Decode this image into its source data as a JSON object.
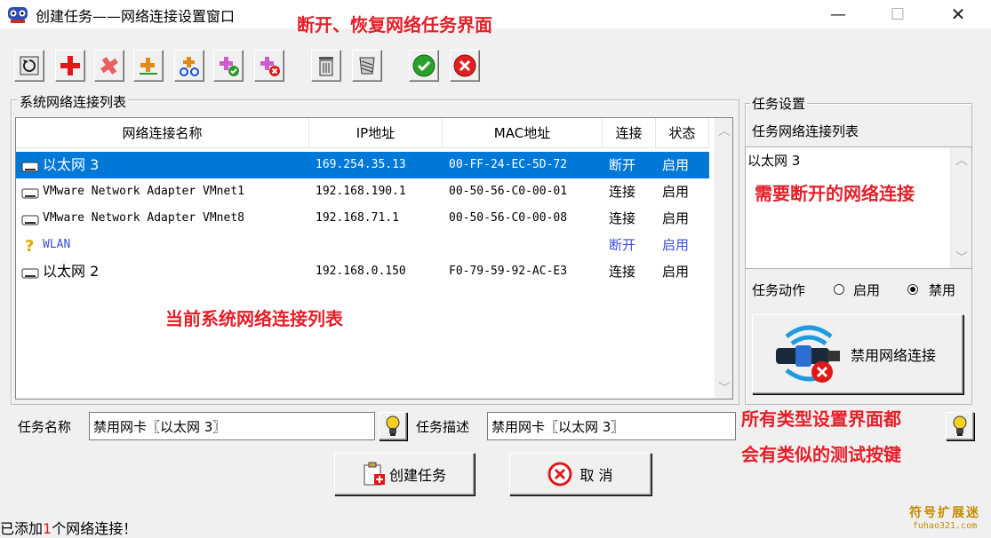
{
  "window": {
    "title": "创建任务——网络连接设置窗口",
    "app_icon": "network-globe-icon",
    "controls": {
      "minimize": "—",
      "maximize": "☐",
      "close": "✕"
    }
  },
  "annotations": {
    "top": "断开、恢复网络任务界面",
    "list": "当前系统网络连接列表",
    "right": "需要断开的网络连接",
    "bottom_line1": "所有类型设置界面都",
    "bottom_line2": "会有类似的测试按键"
  },
  "toolbar": {
    "buttons": [
      {
        "name": "refresh-button",
        "icon": "refresh-icon"
      },
      {
        "name": "add-button",
        "icon": "plus-icon"
      },
      {
        "name": "add-alt-button",
        "icon": "plus-hatched-icon"
      },
      {
        "name": "add-small-button",
        "icon": "plus-small-icon"
      },
      {
        "name": "add-network-button",
        "icon": "network-add-icon"
      },
      {
        "name": "add-network-alt-button",
        "icon": "network-bike-icon"
      },
      {
        "name": "add-enable-button",
        "icon": "plus-check-icon"
      },
      {
        "name": "add-disable-button",
        "icon": "plus-cross-icon"
      },
      {
        "name": "delete-button",
        "icon": "trash-icon"
      },
      {
        "name": "clear-button",
        "icon": "broom-icon"
      },
      {
        "name": "confirm-button",
        "icon": "check-circle-icon"
      },
      {
        "name": "cancel-button",
        "icon": "cross-circle-icon"
      }
    ]
  },
  "system_list": {
    "group_label": "系统网络连接列表",
    "columns": [
      "网络连接名称",
      "IP地址",
      "MAC地址",
      "连接",
      "状态"
    ],
    "rows": [
      {
        "name": "以太网 3",
        "ip": "169.254.35.13",
        "mac": "00-FF-24-EC-5D-72",
        "conn": "断开",
        "state": "启用",
        "icon": "ethernet-icon",
        "selected": true
      },
      {
        "name": "VMware Network Adapter VMnet1",
        "ip": "192.168.190.1",
        "mac": "00-50-56-C0-00-01",
        "conn": "连接",
        "state": "启用",
        "icon": "ethernet-icon"
      },
      {
        "name": "VMware Network Adapter VMnet8",
        "ip": "192.168.71.1",
        "mac": "00-50-56-C0-00-08",
        "conn": "连接",
        "state": "启用",
        "icon": "ethernet-icon"
      },
      {
        "name": "WLAN",
        "ip": "",
        "mac": "",
        "conn": "断开",
        "state": "启用",
        "icon": "wireless-question-icon",
        "disabled_style": true
      },
      {
        "name": "以太网 2",
        "ip": "192.168.0.150",
        "mac": "F0-79-59-92-AC-E3",
        "conn": "连接",
        "state": "启用",
        "icon": "ethernet-icon"
      }
    ]
  },
  "task_settings": {
    "group_label": "任务设置",
    "list_label": "任务网络连接列表",
    "list_items": [
      "以太网 3"
    ],
    "action_label": "任务动作",
    "radio_enable": "启用",
    "radio_disable": "禁用",
    "selected_action": "disable",
    "big_button_label": "禁用网络连接",
    "big_button_icon": "disable-network-icon"
  },
  "form": {
    "task_name_label": "任务名称",
    "task_name_value": "禁用网卡〖以太网 3〗",
    "task_desc_label": "任务描述",
    "task_desc_value": "禁用网卡〖以太网 3〗",
    "test_icon": "lightbulb-icon"
  },
  "buttons": {
    "create": "创建任务",
    "cancel": "取 消"
  },
  "status": {
    "prefix": "已添加",
    "count": "1",
    "suffix": "个网络连接！"
  },
  "watermark": {
    "title": "符号扩展迷",
    "url": "fuhao321.com"
  },
  "colors": {
    "selection": "#0078d7",
    "annotation": "#e4202a",
    "disabled_row": "#3a4fd9"
  }
}
